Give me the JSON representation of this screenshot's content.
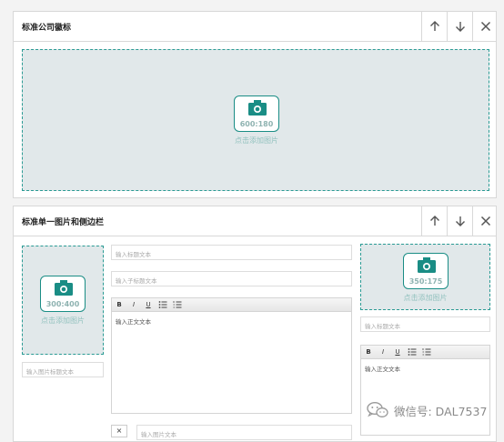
{
  "panel1": {
    "title": "标准公司徽标",
    "image": {
      "dimension": "600:180",
      "hint": "点击添加图片"
    }
  },
  "panel2": {
    "title": "标准单一图片和侧边栏",
    "left_image": {
      "dimension": "300:400",
      "hint": "点击添加图片"
    },
    "left_caption_placeholder": "输入图片标题文本",
    "title_placeholder": "输入标题文本",
    "subtitle_placeholder": "输入子标题文本",
    "body_editor_text": "输入正文文本",
    "bottom_placeholder": "输入图片文本",
    "right_image": {
      "dimension": "350:175",
      "hint": "点击添加图片"
    },
    "right_title_placeholder": "输入标题文本",
    "right_editor_text": "输入正文文本"
  },
  "toolbar": {
    "bold": "B",
    "italic": "I",
    "underline": "U"
  },
  "remove_label": "×",
  "watermark": "微信号: DAL7537",
  "colors": {
    "accent": "#1a8d85",
    "drop_bg": "#e1e8ea",
    "hint_text": "#93c2bf"
  },
  "icons": [
    "arrow-up-icon",
    "arrow-down-icon",
    "close-icon",
    "camera-icon",
    "bullet-list-icon",
    "numbered-list-icon",
    "wechat-icon"
  ]
}
